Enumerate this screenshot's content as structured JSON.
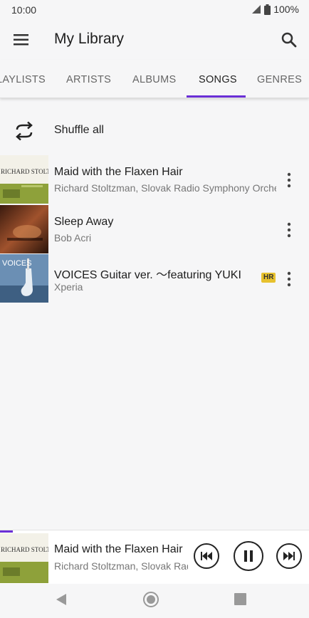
{
  "status_bar": {
    "time": "10:00",
    "battery": "100%"
  },
  "app_bar": {
    "title": "My Library"
  },
  "tabs": [
    {
      "label": "PLAYLISTS",
      "active": false
    },
    {
      "label": "ARTISTS",
      "active": false
    },
    {
      "label": "ALBUMS",
      "active": false
    },
    {
      "label": "SONGS",
      "active": true
    },
    {
      "label": "GENRES",
      "active": false
    }
  ],
  "shuffle": {
    "label": "Shuffle all"
  },
  "songs": [
    {
      "title": "Maid with the Flaxen Hair",
      "artist": "Richard Stoltzman, Slovak Radio Symphony Orchestra",
      "art_text": "RICHARD STOLTZMAN",
      "badge": ""
    },
    {
      "title": "Sleep Away",
      "artist": "Bob Acri",
      "art_text": "",
      "badge": ""
    },
    {
      "title": "VOICES Guitar ver. 〜featuring YUKI",
      "artist": "Xperia",
      "art_text": "VOICES",
      "badge": "HR"
    }
  ],
  "now_playing": {
    "title": "Maid with the Flaxen Hair",
    "artist": "Richard Stoltzman, Slovak Radio Symphony Orchestra",
    "art_text": "RICHARD STOLTZMAN",
    "state": "playing"
  },
  "colors": {
    "accent": "#6a2fd6",
    "hr_badge": "#e7c12e",
    "background": "#f6f6f7"
  }
}
